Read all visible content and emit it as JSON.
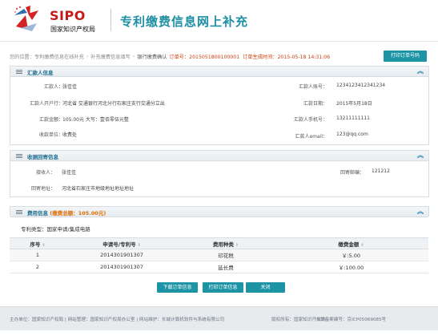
{
  "header": {
    "logo_text": "SIPO",
    "logo_sub": "国家知识产权局",
    "title": "专利缴费信息网上补充"
  },
  "breadcrumb": {
    "prefix": "您的位置：",
    "items": [
      "专利缴费信息在线补充",
      "补充缴费信息填写",
      "银行缴费确认"
    ],
    "order_no": "订单号：2015051800100001",
    "order_time": "订单生成时间：2015-05-18 14:31:06",
    "print_button": "打印订单号码"
  },
  "remitter": {
    "title": "汇款人信息",
    "name_label": "汇款人：",
    "name": "张佳佳",
    "bank_label": "汇款人开户行：",
    "bank": "河北省 交通银行河北分行石家庄支行交通分立出",
    "amount_label": "汇款金额：",
    "amount": "105.00元  大写：壹佰零伍元整",
    "payee_label": "收款单位：",
    "payee": "收费处",
    "account_label": "汇款人账号：",
    "account": "1234123412341234",
    "date_label": "汇款日期：",
    "date": "2015年5月18日",
    "phone_label": "汇款人手机号：",
    "phone": "13211111111",
    "email_label": "汇款人email：",
    "email": "123@qq.com"
  },
  "receipt": {
    "title": "收据回寄信息",
    "recipient_label": "接收人：",
    "recipient": "张佳佳",
    "address_label": "回寄地址：",
    "address": "河北省石家庄市地级地址地址地址",
    "postcode_label": "回寄邮编：",
    "postcode": "121212"
  },
  "fees": {
    "title": "费用信息",
    "total": "(缴费总额：105.00元)",
    "type_label": "专利类型：",
    "type_value": "国家申请/集成电路",
    "columns": [
      "序号",
      "申请号/专利号",
      "费用种类",
      "缴费金额"
    ],
    "rows": [
      {
        "no": "1",
        "app_no": "2014301901307",
        "fee_type": "印花税",
        "amount": "￥:5.00"
      },
      {
        "no": "2",
        "app_no": "2014301901307",
        "fee_type": "延长费",
        "amount": "￥:100.00"
      }
    ]
  },
  "actions": {
    "download": "下载订单信息",
    "print": "打印订单信息",
    "close": "关闭"
  },
  "footer": {
    "left": "主办单位：国家知识产权局 | 网站管理：国家知识产权局办公室 | 网站维护：长城计算机软件与系统有限公司",
    "copyright": "版权所有：国家知识产权局",
    "icp": "| ICP备案编号：京ICP05069085号"
  },
  "colors": {
    "accent": "#1d94a5",
    "title": "#1f8fa3",
    "brand_red": "#c51a1a",
    "order_orange": "#d04010"
  }
}
